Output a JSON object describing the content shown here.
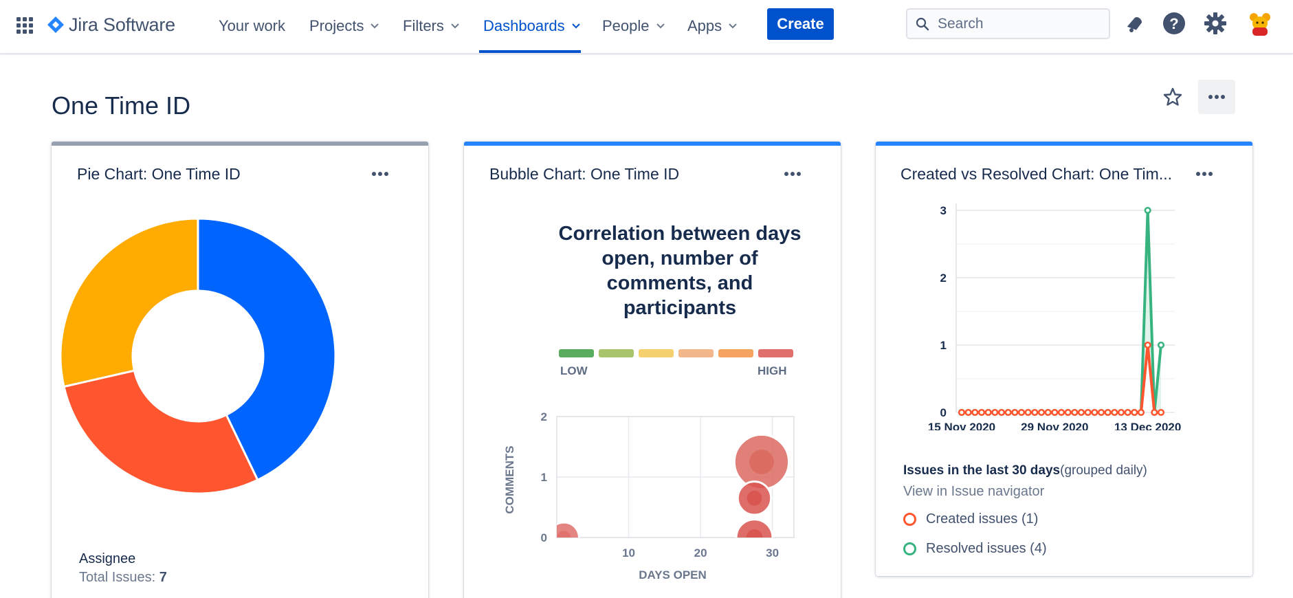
{
  "app": {
    "name": "Jira Software",
    "accent": "#0052cc"
  },
  "nav": {
    "items": [
      {
        "label": "Your work"
      },
      {
        "label": "Projects"
      },
      {
        "label": "Filters"
      },
      {
        "label": "Dashboards"
      },
      {
        "label": "People"
      },
      {
        "label": "Apps"
      }
    ],
    "active": "Dashboards",
    "create_label": "Create",
    "search_placeholder": "Search",
    "icons": [
      "app-switcher-icon",
      "notifications-icon",
      "help-icon",
      "settings-icon",
      "avatar"
    ]
  },
  "page": {
    "title": "One Time ID"
  },
  "gadgets": {
    "pie": {
      "title": "Pie Chart: One Time ID",
      "bar_color": "#97a0af",
      "footer_label": "Assignee",
      "total_label": "Total Issues:",
      "total_value": "7"
    },
    "bubble": {
      "title": "Bubble Chart: One Time ID",
      "bar_color": "#2684ff",
      "heading_lines": [
        "Correlation between days",
        "open, number of",
        "comments, and",
        "participants"
      ],
      "legend_low": "LOW",
      "legend_high": "HIGH",
      "legend_colors": [
        "#5aac5e",
        "#a8c46d",
        "#f5d06f",
        "#f2b78a",
        "#f4a460",
        "#e0706b"
      ],
      "x_axis_label": "DAYS OPEN",
      "y_axis_label": "COMMENTS"
    },
    "created_resolved": {
      "title": "Created vs Resolved Chart: One Tim...",
      "bar_color": "#2684ff",
      "summary_bold": "Issues in the last 30 days",
      "summary_grouped": "(grouped daily)",
      "link_label": "View in Issue navigator",
      "legend": [
        {
          "label": "Created issues (1)",
          "color": "#ff5630"
        },
        {
          "label": "Resolved issues (4)",
          "color": "#36b37e"
        }
      ]
    }
  },
  "chart_data": [
    {
      "type": "pie",
      "donut": true,
      "values": [
        3,
        2,
        2
      ],
      "colors": [
        "#0065ff",
        "#ff5630",
        "#ffab00"
      ]
    },
    {
      "type": "scatter",
      "bubble": true,
      "xlabel": "DAYS OPEN",
      "ylabel": "COMMENTS",
      "x_ticks": [
        10,
        20,
        30
      ],
      "y_ticks": [
        0,
        1,
        2
      ],
      "xlim": [
        0,
        33
      ],
      "ylim": [
        0,
        2
      ],
      "points": [
        {
          "x": 1,
          "y": 0,
          "size": 1.0,
          "color": "#e0706b"
        },
        {
          "x": 28.5,
          "y": 1.25,
          "size": 1.8,
          "color": "#db6a60"
        },
        {
          "x": 27.5,
          "y": 0.65,
          "size": 1.1,
          "color": "#d9534f"
        },
        {
          "x": 27.5,
          "y": 0,
          "size": 1.2,
          "color": "#d9534f"
        }
      ]
    },
    {
      "type": "line",
      "x_tick_labels": [
        "15 Nov 2020",
        "29 Nov 2020",
        "13 Dec 2020"
      ],
      "y_ticks": [
        0,
        1,
        2,
        3
      ],
      "ylim": [
        0,
        3
      ],
      "series": [
        {
          "name": "Created issues (1)",
          "color": "#ff5630",
          "values": [
            0,
            0,
            0,
            0,
            0,
            0,
            0,
            0,
            0,
            0,
            0,
            0,
            0,
            0,
            0,
            0,
            0,
            0,
            0,
            0,
            0,
            0,
            0,
            0,
            0,
            0,
            0,
            0,
            1,
            0,
            0
          ]
        },
        {
          "name": "Resolved issues (4)",
          "color": "#36b37e",
          "values": [
            0,
            0,
            0,
            0,
            0,
            0,
            0,
            0,
            0,
            0,
            0,
            0,
            0,
            0,
            0,
            0,
            0,
            0,
            0,
            0,
            0,
            0,
            0,
            0,
            0,
            0,
            0,
            0,
            3,
            0,
            1
          ]
        }
      ]
    }
  ]
}
